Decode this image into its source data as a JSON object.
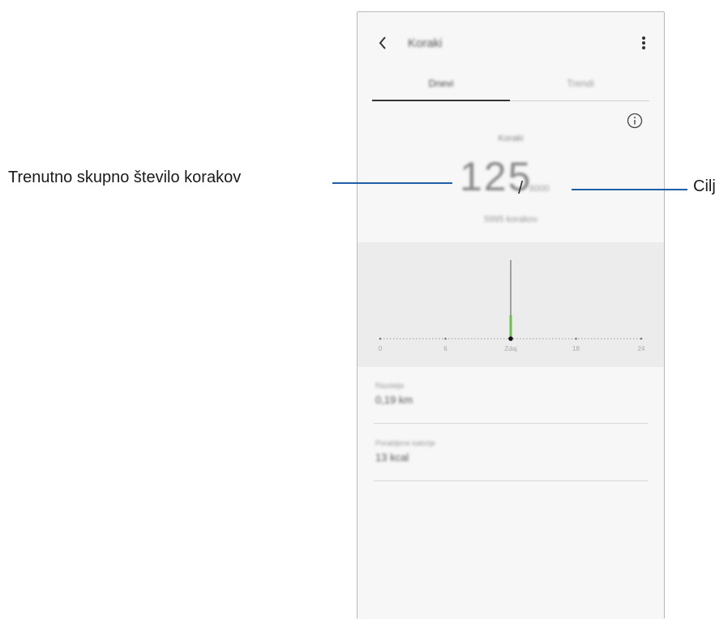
{
  "app": {
    "title": "Koraki",
    "menu_icon": "more-vertical-icon",
    "back_icon": "back-arrow-icon",
    "info_icon": "info-icon"
  },
  "tabs": [
    {
      "label": "Dnevi"
    },
    {
      "label": "Trendi"
    }
  ],
  "steps": {
    "label": "Koraki",
    "count": "125",
    "target": "6000",
    "sub": "5995 korakov"
  },
  "chart_data": {
    "type": "bar",
    "x_ticks": [
      "0",
      "6",
      "Zdaj",
      "18",
      "24"
    ],
    "current_marker": "Zdaj"
  },
  "stats": [
    {
      "label": "Razdalja",
      "value": "0,19 km"
    },
    {
      "label": "Porabljene kalorije",
      "value": "13 kcal"
    }
  ],
  "callouts": {
    "left": "Trenutno skupno število korakov",
    "right": "Cilj"
  },
  "colors": {
    "accent": "#1f5fa8",
    "bar_green": "#6cbf4a"
  }
}
